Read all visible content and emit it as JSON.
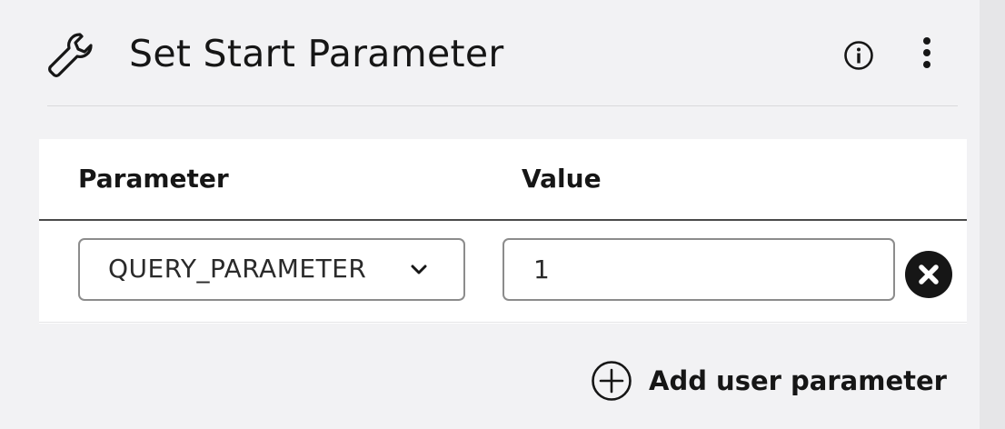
{
  "panel": {
    "title": "Set Start Parameter",
    "icons": {
      "leading": "wrench-icon",
      "info": "info-icon",
      "menu": "more-vertical-icon"
    }
  },
  "table": {
    "columns": [
      "Parameter",
      "Value"
    ],
    "rows": [
      {
        "parameter": "QUERY_PARAMETER",
        "value": "1"
      }
    ]
  },
  "actions": {
    "add_label": "Add user parameter",
    "add_icon": "plus-circle-icon",
    "remove_icon": "remove-circle-icon"
  }
}
